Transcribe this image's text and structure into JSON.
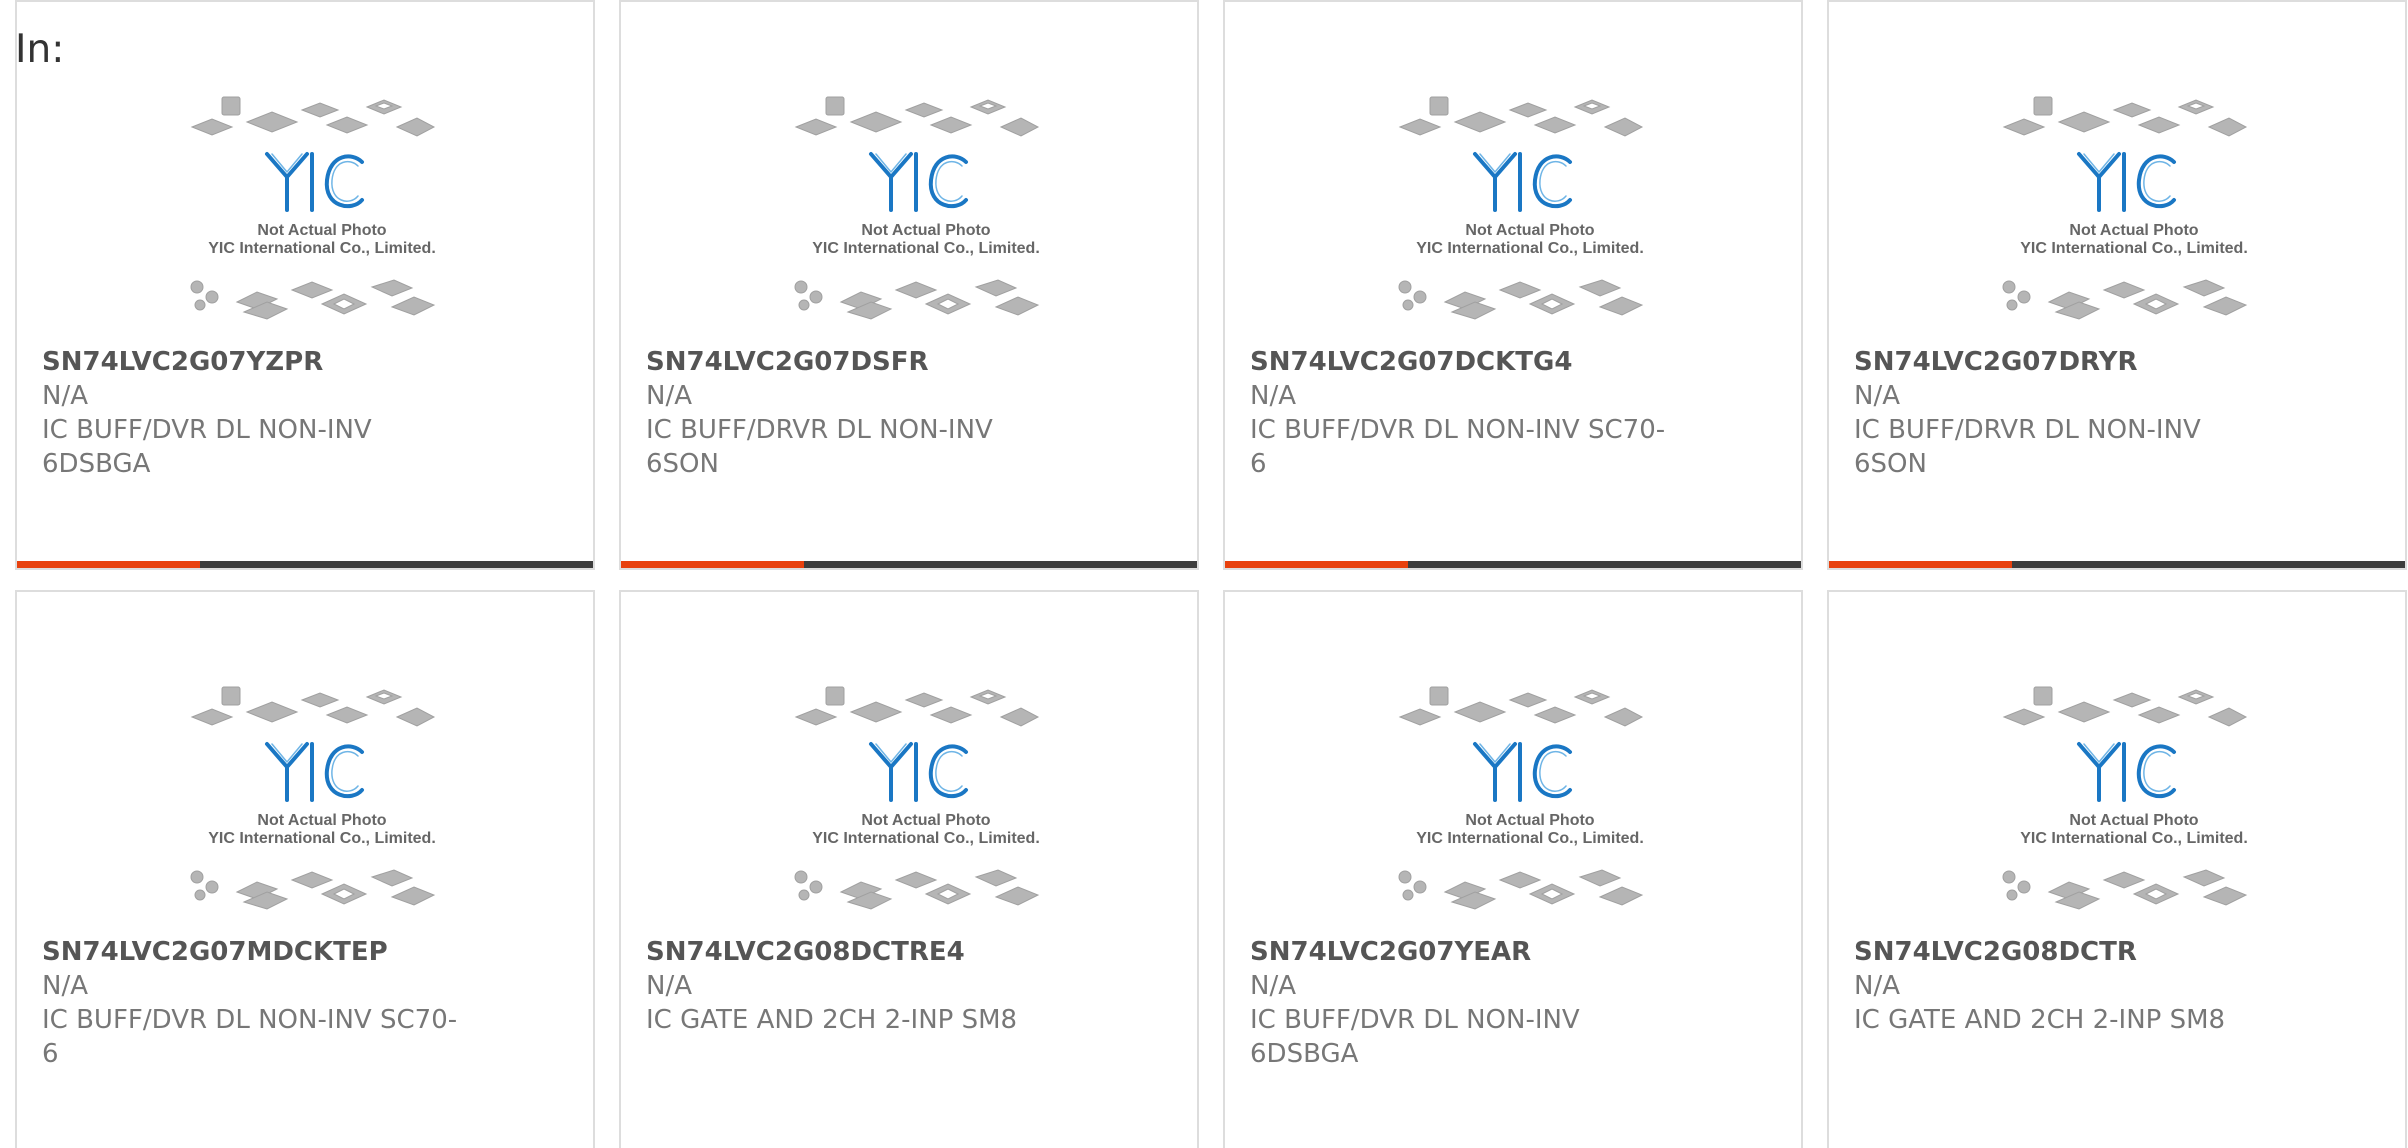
{
  "header": {
    "label": "In:"
  },
  "colors": {
    "accent": "#e8410e",
    "bar": "#3d3d3d",
    "logo_blue": "#1a77c4"
  },
  "placeholder": {
    "line1": "Not Actual Photo",
    "line2": "YIC International Co., Limited.",
    "logo_text": "YIC"
  },
  "products": [
    {
      "part_number": "SN74LVC2G07YZPR",
      "manufacturer": "N/A",
      "description": "IC BUFF/DVR DL NON-INV 6DSBGA",
      "desc_line1": "IC BUFF/DVR DL NON-INV",
      "desc_line2": "6DSBGA"
    },
    {
      "part_number": "SN74LVC2G07DSFR",
      "manufacturer": "N/A",
      "description": "IC BUFF/DRVR DL NON-INV 6SON",
      "desc_line1": "IC BUFF/DRVR DL NON-INV",
      "desc_line2": "6SON"
    },
    {
      "part_number": "SN74LVC2G07DCKTG4",
      "manufacturer": "N/A",
      "description": "IC BUFF/DVR DL NON-INV SC70-6",
      "desc_line1": "IC BUFF/DVR DL NON-INV SC70-",
      "desc_line2": "6"
    },
    {
      "part_number": "SN74LVC2G07DRYR",
      "manufacturer": "N/A",
      "description": "IC BUFF/DRVR DL NON-INV 6SON",
      "desc_line1": "IC BUFF/DRVR DL NON-INV",
      "desc_line2": "6SON"
    },
    {
      "part_number": "SN74LVC2G07MDCKTEP",
      "manufacturer": "N/A",
      "description": "IC BUFF/DVR DL NON-INV SC70-6",
      "desc_line1": "IC BUFF/DVR DL NON-INV SC70-",
      "desc_line2": "6"
    },
    {
      "part_number": "SN74LVC2G08DCTRE4",
      "manufacturer": "N/A",
      "description": "IC GATE AND 2CH 2-INP SM8",
      "desc_line1": "IC GATE AND 2CH 2-INP SM8",
      "desc_line2": ""
    },
    {
      "part_number": "SN74LVC2G07YEAR",
      "manufacturer": "N/A",
      "description": "IC BUFF/DVR DL NON-INV 6DSBGA",
      "desc_line1": "IC BUFF/DVR DL NON-INV",
      "desc_line2": "6DSBGA"
    },
    {
      "part_number": "SN74LVC2G08DCTR",
      "manufacturer": "N/A",
      "description": "IC GATE AND 2CH 2-INP SM8",
      "desc_line1": "IC GATE AND 2CH 2-INP SM8",
      "desc_line2": ""
    }
  ]
}
